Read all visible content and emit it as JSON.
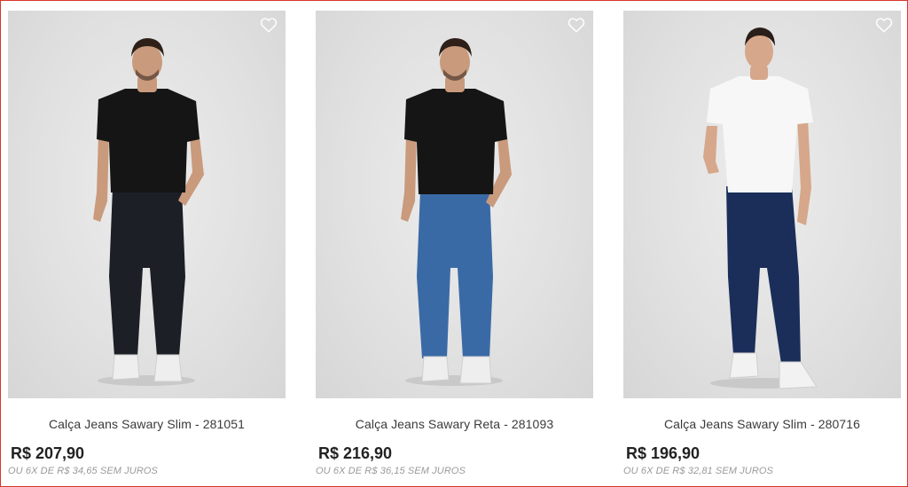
{
  "colors": {
    "border": "#d9342b",
    "heart": "#ffffff",
    "title": "#3a3a3a",
    "price": "#222222",
    "installments": "#9a9a9a"
  },
  "icons": {
    "favorite": "heart-outline-icon"
  },
  "products": [
    {
      "name": "Calça Jeans Sawary Slim - 281051",
      "price": "R$ 207,90",
      "installments": "OU 6X DE R$ 34,65 SEM JUROS",
      "tshirt_color": "#151515",
      "jeans_color": "#1c1f26",
      "skin_color": "#c99a7c",
      "hair_color": "#2e2019"
    },
    {
      "name": "Calça Jeans Sawary Reta - 281093",
      "price": "R$ 216,90",
      "installments": "OU 6X DE R$ 36,15 SEM JUROS",
      "tshirt_color": "#151515",
      "jeans_color": "#3a6aa6",
      "skin_color": "#c99a7c",
      "hair_color": "#2e2019"
    },
    {
      "name": "Calça Jeans Sawary Slim - 280716",
      "price": "R$ 196,90",
      "installments": "OU 6X DE R$ 32,81 SEM JUROS",
      "tshirt_color": "#f7f7f7",
      "jeans_color": "#1b2e5a",
      "skin_color": "#d6a78a",
      "hair_color": "#2a1e18"
    }
  ]
}
